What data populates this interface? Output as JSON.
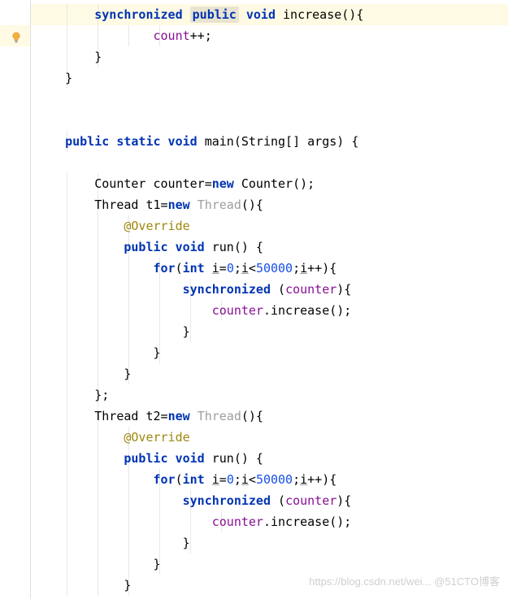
{
  "code": {
    "lines": [
      {
        "indent": "        ",
        "tokens": [
          {
            "t": "synchronized ",
            "c": "keyword"
          },
          {
            "t": "public",
            "c": "keyword boxed"
          },
          {
            "t": " ",
            "c": ""
          },
          {
            "t": "void",
            "c": "keyword"
          },
          {
            "t": " increase(){",
            "c": ""
          }
        ],
        "hl": true
      },
      {
        "indent": "                ",
        "tokens": [
          {
            "t": "count",
            "c": "field"
          },
          {
            "t": "++;",
            "c": ""
          }
        ]
      },
      {
        "indent": "        ",
        "tokens": [
          {
            "t": "}",
            "c": ""
          }
        ]
      },
      {
        "indent": "    ",
        "tokens": [
          {
            "t": "}",
            "c": ""
          }
        ]
      },
      {
        "indent": "",
        "tokens": []
      },
      {
        "indent": "",
        "tokens": []
      },
      {
        "indent": "    ",
        "tokens": [
          {
            "t": "public static void",
            "c": "keyword"
          },
          {
            "t": " main(String[] args) {",
            "c": ""
          }
        ]
      },
      {
        "indent": "",
        "tokens": []
      },
      {
        "indent": "        ",
        "tokens": [
          {
            "t": "Counter counter=",
            "c": ""
          },
          {
            "t": "new",
            "c": "new-kw"
          },
          {
            "t": " Counter();",
            "c": ""
          }
        ]
      },
      {
        "indent": "        ",
        "tokens": [
          {
            "t": "Thread t1=",
            "c": ""
          },
          {
            "t": "new",
            "c": "new-kw"
          },
          {
            "t": " ",
            "c": ""
          },
          {
            "t": "Thread",
            "c": "class-ref"
          },
          {
            "t": "(){",
            "c": ""
          }
        ]
      },
      {
        "indent": "            ",
        "tokens": [
          {
            "t": "@Override",
            "c": "annotation"
          }
        ]
      },
      {
        "indent": "            ",
        "tokens": [
          {
            "t": "public void",
            "c": "keyword"
          },
          {
            "t": " run() {",
            "c": ""
          }
        ]
      },
      {
        "indent": "                ",
        "tokens": [
          {
            "t": "for",
            "c": "keyword"
          },
          {
            "t": "(",
            "c": ""
          },
          {
            "t": "int",
            "c": "keyword"
          },
          {
            "t": " ",
            "c": ""
          },
          {
            "t": "i",
            "c": "underlined"
          },
          {
            "t": "=",
            "c": ""
          },
          {
            "t": "0",
            "c": "number"
          },
          {
            "t": ";",
            "c": ""
          },
          {
            "t": "i",
            "c": "underlined"
          },
          {
            "t": "<",
            "c": ""
          },
          {
            "t": "50000",
            "c": "number"
          },
          {
            "t": ";",
            "c": ""
          },
          {
            "t": "i",
            "c": "underlined"
          },
          {
            "t": "++){",
            "c": ""
          }
        ]
      },
      {
        "indent": "                    ",
        "tokens": [
          {
            "t": "synchronized",
            "c": "keyword"
          },
          {
            "t": " (",
            "c": ""
          },
          {
            "t": "counter",
            "c": "field"
          },
          {
            "t": "){",
            "c": ""
          }
        ]
      },
      {
        "indent": "                        ",
        "tokens": [
          {
            "t": "counter",
            "c": "field"
          },
          {
            "t": ".increase();",
            "c": ""
          }
        ]
      },
      {
        "indent": "                    ",
        "tokens": [
          {
            "t": "}",
            "c": ""
          }
        ]
      },
      {
        "indent": "                ",
        "tokens": [
          {
            "t": "}",
            "c": ""
          }
        ]
      },
      {
        "indent": "            ",
        "tokens": [
          {
            "t": "}",
            "c": ""
          }
        ]
      },
      {
        "indent": "        ",
        "tokens": [
          {
            "t": "};",
            "c": ""
          }
        ]
      },
      {
        "indent": "        ",
        "tokens": [
          {
            "t": "Thread t2=",
            "c": ""
          },
          {
            "t": "new",
            "c": "new-kw"
          },
          {
            "t": " ",
            "c": ""
          },
          {
            "t": "Thread",
            "c": "class-ref"
          },
          {
            "t": "(){",
            "c": ""
          }
        ]
      },
      {
        "indent": "            ",
        "tokens": [
          {
            "t": "@Override",
            "c": "annotation"
          }
        ]
      },
      {
        "indent": "            ",
        "tokens": [
          {
            "t": "public void",
            "c": "keyword"
          },
          {
            "t": " run() {",
            "c": ""
          }
        ]
      },
      {
        "indent": "                ",
        "tokens": [
          {
            "t": "for",
            "c": "keyword"
          },
          {
            "t": "(",
            "c": ""
          },
          {
            "t": "int",
            "c": "keyword"
          },
          {
            "t": " ",
            "c": ""
          },
          {
            "t": "i",
            "c": "underlined"
          },
          {
            "t": "=",
            "c": ""
          },
          {
            "t": "0",
            "c": "number"
          },
          {
            "t": ";",
            "c": ""
          },
          {
            "t": "i",
            "c": "underlined"
          },
          {
            "t": "<",
            "c": ""
          },
          {
            "t": "50000",
            "c": "number"
          },
          {
            "t": ";",
            "c": ""
          },
          {
            "t": "i",
            "c": "underlined"
          },
          {
            "t": "++){",
            "c": ""
          }
        ]
      },
      {
        "indent": "                    ",
        "tokens": [
          {
            "t": "synchronized",
            "c": "keyword"
          },
          {
            "t": " (",
            "c": ""
          },
          {
            "t": "counter",
            "c": "field"
          },
          {
            "t": "){",
            "c": ""
          }
        ]
      },
      {
        "indent": "                        ",
        "tokens": [
          {
            "t": "counter",
            "c": "field"
          },
          {
            "t": ".increase();",
            "c": ""
          }
        ]
      },
      {
        "indent": "                    ",
        "tokens": [
          {
            "t": "}",
            "c": ""
          }
        ]
      },
      {
        "indent": "                ",
        "tokens": [
          {
            "t": "}",
            "c": ""
          }
        ]
      },
      {
        "indent": "            ",
        "tokens": [
          {
            "t": "}",
            "c": ""
          }
        ]
      }
    ]
  },
  "watermark": "https://blog.csdn.net/wei... @51CTO博客",
  "icons": {
    "bulb": "lightbulb-icon"
  }
}
